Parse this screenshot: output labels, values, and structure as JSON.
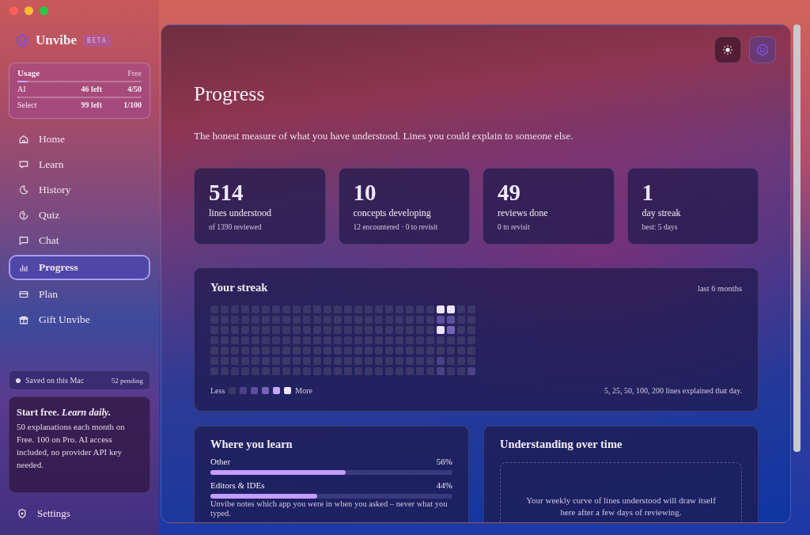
{
  "sidebar": {
    "brand": "Unvibe",
    "badge": "BETA",
    "usage": {
      "title": "Usage",
      "plan": "Free",
      "meters": [
        {
          "label": "AI",
          "remaining": "46 left",
          "count": "4/50",
          "level": 0.08
        },
        {
          "label": "Select",
          "remaining": "99 left",
          "count": "1/100",
          "level": 0.01
        }
      ]
    },
    "nav": [
      {
        "label": "Home",
        "selected": false
      },
      {
        "label": "Learn",
        "selected": false
      },
      {
        "label": "History",
        "selected": false
      },
      {
        "label": "Quiz",
        "selected": false
      },
      {
        "label": "Chat",
        "selected": false
      },
      {
        "label": "Progress",
        "selected": true
      },
      {
        "label": "Plan",
        "selected": false
      },
      {
        "label": "Gift Unvibe",
        "selected": false
      }
    ],
    "sync": {
      "label": "Saved on this Mac",
      "pending": "52 pending"
    },
    "promo": {
      "heading": "Start free. *Learn daily.*",
      "text": "50 explanations each month on Free. 100 on Pro. AI access included, no provider API key needed."
    },
    "settings": "Settings"
  },
  "page": {
    "title": "Progress",
    "subtitle": "The honest measure of what you have understood. Lines you could explain to someone else."
  },
  "stats": [
    {
      "value": "514",
      "label": "lines understood",
      "detail": "of 1390 reviewed"
    },
    {
      "value": "10",
      "label": "concepts developing",
      "detail": "12 encountered · 0 to revisit"
    },
    {
      "value": "49",
      "label": "reviews done",
      "detail": "0 to revisit"
    },
    {
      "value": "1",
      "label": "day streak",
      "detail": "best: 5 days"
    }
  ],
  "streak": {
    "title": "Your streak",
    "range": "last 6 months",
    "weeks": [
      {
        "days": [
          {
            "color": "#3b3769"
          },
          {
            "color": "#3b3769"
          },
          {
            "color": "#3b3769"
          },
          {
            "color": "#3b3769"
          },
          {
            "color": "#3b3769"
          },
          {
            "color": "#3b3769"
          },
          {
            "color": "#3b3769"
          }
        ]
      },
      {
        "days": [
          {
            "color": "#3b3769"
          },
          {
            "color": "#3b3769"
          },
          {
            "color": "#3b3769"
          },
          {
            "color": "#3b3769"
          },
          {
            "color": "#3b3769"
          },
          {
            "color": "#3b3769"
          },
          {
            "color": "#3b3769"
          }
        ]
      },
      {
        "days": [
          {
            "color": "#3b3769"
          },
          {
            "color": "#3b3769"
          },
          {
            "color": "#3b3769"
          },
          {
            "color": "#3b3769"
          },
          {
            "color": "#3b3769"
          },
          {
            "color": "#3b3769"
          },
          {
            "color": "#3b3769"
          }
        ]
      },
      {
        "days": [
          {
            "color": "#3b3769"
          },
          {
            "color": "#3b3769"
          },
          {
            "color": "#3b3769"
          },
          {
            "color": "#3b3769"
          },
          {
            "color": "#3b3769"
          },
          {
            "color": "#3b3769"
          },
          {
            "color": "#3b3769"
          }
        ]
      },
      {
        "days": [
          {
            "color": "#3b3769"
          },
          {
            "color": "#3b3769"
          },
          {
            "color": "#3b3769"
          },
          {
            "color": "#3b3769"
          },
          {
            "color": "#3b3769"
          },
          {
            "color": "#3b3769"
          },
          {
            "color": "#3b3769"
          }
        ]
      },
      {
        "days": [
          {
            "color": "#3b3769"
          },
          {
            "color": "#3b3769"
          },
          {
            "color": "#3b3769"
          },
          {
            "color": "#3b3769"
          },
          {
            "color": "#3b3769"
          },
          {
            "color": "#3b3769"
          },
          {
            "color": "#3b3769"
          }
        ]
      },
      {
        "days": [
          {
            "color": "#3b3769"
          },
          {
            "color": "#3b3769"
          },
          {
            "color": "#3b3769"
          },
          {
            "color": "#3b3769"
          },
          {
            "color": "#3b3769"
          },
          {
            "color": "#3b3769"
          },
          {
            "color": "#3b3769"
          }
        ]
      },
      {
        "days": [
          {
            "color": "#3b3769"
          },
          {
            "color": "#3b3769"
          },
          {
            "color": "#3b3769"
          },
          {
            "color": "#3b3769"
          },
          {
            "color": "#3b3769"
          },
          {
            "color": "#3b3769"
          },
          {
            "color": "#3b3769"
          }
        ]
      },
      {
        "days": [
          {
            "color": "#3b3769"
          },
          {
            "color": "#3b3769"
          },
          {
            "color": "#3b3769"
          },
          {
            "color": "#3b3769"
          },
          {
            "color": "#3b3769"
          },
          {
            "color": "#3b3769"
          },
          {
            "color": "#3b3769"
          }
        ]
      },
      {
        "days": [
          {
            "color": "#3b3769"
          },
          {
            "color": "#3b3769"
          },
          {
            "color": "#3b3769"
          },
          {
            "color": "#3b3769"
          },
          {
            "color": "#3b3769"
          },
          {
            "color": "#3b3769"
          },
          {
            "color": "#3b3769"
          }
        ]
      },
      {
        "days": [
          {
            "color": "#3b3769"
          },
          {
            "color": "#3b3769"
          },
          {
            "color": "#3b3769"
          },
          {
            "color": "#3b3769"
          },
          {
            "color": "#3b3769"
          },
          {
            "color": "#3b3769"
          },
          {
            "color": "#3b3769"
          }
        ]
      },
      {
        "days": [
          {
            "color": "#3b3769"
          },
          {
            "color": "#3b3769"
          },
          {
            "color": "#3b3769"
          },
          {
            "color": "#3b3769"
          },
          {
            "color": "#3b3769"
          },
          {
            "color": "#3b3769"
          },
          {
            "color": "#3b3769"
          }
        ]
      },
      {
        "days": [
          {
            "color": "#3b3769"
          },
          {
            "color": "#3b3769"
          },
          {
            "color": "#3b3769"
          },
          {
            "color": "#3b3769"
          },
          {
            "color": "#3b3769"
          },
          {
            "color": "#3b3769"
          },
          {
            "color": "#3b3769"
          }
        ]
      },
      {
        "days": [
          {
            "color": "#3b3769"
          },
          {
            "color": "#3b3769"
          },
          {
            "color": "#3b3769"
          },
          {
            "color": "#3b3769"
          },
          {
            "color": "#3b3769"
          },
          {
            "color": "#3b3769"
          },
          {
            "color": "#3b3769"
          }
        ]
      },
      {
        "days": [
          {
            "color": "#3b3769"
          },
          {
            "color": "#3b3769"
          },
          {
            "color": "#3b3769"
          },
          {
            "color": "#3b3769"
          },
          {
            "color": "#3b3769"
          },
          {
            "color": "#3b3769"
          },
          {
            "color": "#3b3769"
          }
        ]
      },
      {
        "days": [
          {
            "color": "#3b3769"
          },
          {
            "color": "#3b3769"
          },
          {
            "color": "#3b3769"
          },
          {
            "color": "#3b3769"
          },
          {
            "color": "#3b3769"
          },
          {
            "color": "#3b3769"
          },
          {
            "color": "#3b3769"
          }
        ]
      },
      {
        "days": [
          {
            "color": "#3b3769"
          },
          {
            "color": "#3b3769"
          },
          {
            "color": "#3b3769"
          },
          {
            "color": "#3b3769"
          },
          {
            "color": "#3b3769"
          },
          {
            "color": "#3b3769"
          },
          {
            "color": "#3b3769"
          }
        ]
      },
      {
        "days": [
          {
            "color": "#3b3769"
          },
          {
            "color": "#3b3769"
          },
          {
            "color": "#3b3769"
          },
          {
            "color": "#3b3769"
          },
          {
            "color": "#3b3769"
          },
          {
            "color": "#3b3769"
          },
          {
            "color": "#3b3769"
          }
        ]
      },
      {
        "days": [
          {
            "color": "#3b3769"
          },
          {
            "color": "#3b3769"
          },
          {
            "color": "#3b3769"
          },
          {
            "color": "#3b3769"
          },
          {
            "color": "#3b3769"
          },
          {
            "color": "#3b3769"
          },
          {
            "color": "#3b3769"
          }
        ]
      },
      {
        "days": [
          {
            "color": "#3b3769"
          },
          {
            "color": "#3b3769"
          },
          {
            "color": "#3b3769"
          },
          {
            "color": "#3b3769"
          },
          {
            "color": "#3b3769"
          },
          {
            "color": "#3b3769"
          },
          {
            "color": "#3b3769"
          }
        ]
      },
      {
        "days": [
          {
            "color": "#3b3769"
          },
          {
            "color": "#3b3769"
          },
          {
            "color": "#3b3769"
          },
          {
            "color": "#3b3769"
          },
          {
            "color": "#3b3769"
          },
          {
            "color": "#3b3769"
          },
          {
            "color": "#3b3769"
          }
        ]
      },
      {
        "days": [
          {
            "color": "#3b3769"
          },
          {
            "color": "#3b3769"
          },
          {
            "color": "#3b3769"
          },
          {
            "color": "#3b3769"
          },
          {
            "color": "#3b3769"
          },
          {
            "color": "#3b3769"
          },
          {
            "color": "#3b3769"
          }
        ]
      },
      {
        "days": [
          {
            "color": "#ece6ff"
          },
          {
            "color": "#5d4f9c"
          },
          {
            "color": "#ece6ff"
          },
          {
            "color": "#3b3769"
          },
          {
            "color": "#3b3769"
          },
          {
            "color": "#4a4282"
          },
          {
            "color": "#4a4282"
          }
        ]
      },
      {
        "days": [
          {
            "color": "#ece6ff"
          },
          {
            "color": "#5d4f9c"
          },
          {
            "color": "#7764b8"
          },
          {
            "color": "#3b3769"
          },
          {
            "color": "#3b3769"
          },
          {
            "color": "#3b3769"
          },
          {
            "color": "#3b3769"
          }
        ]
      },
      {
        "days": [
          {
            "color": "#3b3769"
          },
          {
            "color": "#3b3769"
          },
          {
            "color": "#3b3769"
          },
          {
            "color": "#3b3769"
          },
          {
            "color": "#3b3769"
          },
          {
            "color": "#3b3769"
          },
          {
            "color": "#3b3769"
          }
        ]
      },
      {
        "days": [
          {
            "color": "#3b3769"
          },
          {
            "color": "#3b3769"
          },
          {
            "color": "#3b3769"
          },
          {
            "color": "#3b3769"
          },
          {
            "color": "#3b3769"
          },
          {
            "color": "#3b3769"
          },
          {
            "color": "#4a4282"
          }
        ]
      }
    ],
    "legend": {
      "less": "Less",
      "more": "More",
      "swatches": [
        {
          "color": "#3b3769"
        },
        {
          "color": "#4a4282"
        },
        {
          "color": "#5d4f9c"
        },
        {
          "color": "#7764b8"
        },
        {
          "color": "#c4a6fb"
        },
        {
          "color": "#ece6ff"
        }
      ]
    },
    "caption": "5, 25, 50, 100, 200 lines explained that day."
  },
  "sources": {
    "title": "Where you learn",
    "items": [
      {
        "label": "Other",
        "percent": "56%",
        "level": 0.56
      },
      {
        "label": "Editors & IDEs",
        "percent": "44%",
        "level": 0.44
      }
    ],
    "note": "Unvibe notes which app you were in when you asked – never what you typed."
  },
  "trend": {
    "title": "Understanding over time",
    "empty_text": "Your weekly curve of lines understood will draw itself here after a few days of reviewing."
  }
}
